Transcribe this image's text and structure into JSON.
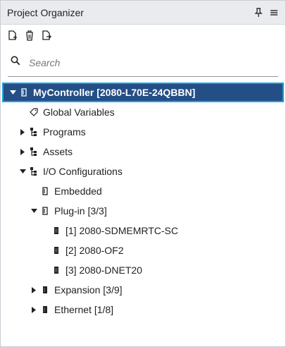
{
  "panel": {
    "title": "Project Organizer"
  },
  "search": {
    "placeholder": "Search"
  },
  "tree": {
    "controller": "MyController [2080-L70E-24QBBN]",
    "global_variables": "Global Variables",
    "programs": "Programs",
    "assets": "Assets",
    "io_configurations": "I/O Configurations",
    "embedded": "Embedded",
    "plugin": "Plug-in [3/3]",
    "plugin_items": [
      "[1] 2080-SDMEMRTC-SC",
      "[2] 2080-OF2",
      "[3] 2080-DNET20"
    ],
    "expansion": "Expansion [3/9]",
    "ethernet": "Ethernet [1/8]"
  },
  "colors": {
    "selected_bg": "#244e86",
    "selected_border": "#1fa1e0",
    "titlebar_bg": "#e9ebef"
  }
}
